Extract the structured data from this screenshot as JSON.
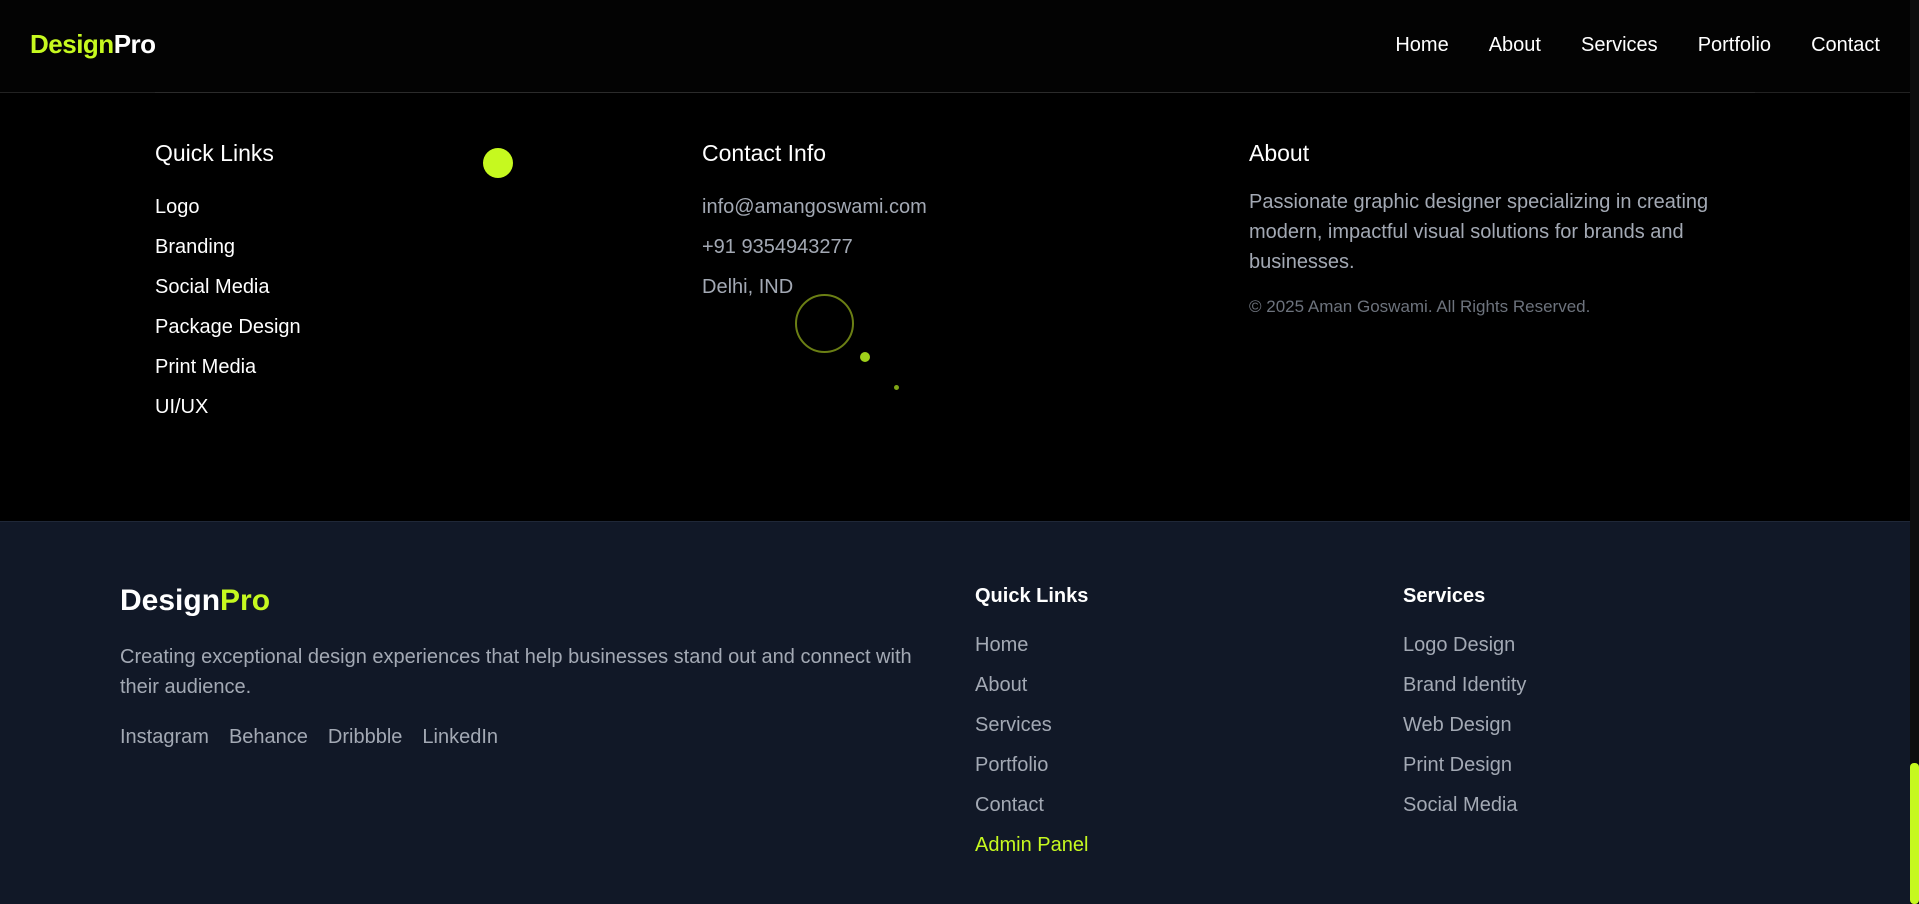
{
  "nav": {
    "logo_part1": "Design",
    "logo_part2": "Pro",
    "links": [
      "Home",
      "About",
      "Services",
      "Portfolio",
      "Contact"
    ]
  },
  "upper": {
    "quick_links": {
      "title": "Quick Links",
      "items": [
        "Logo",
        "Branding",
        "Social Media",
        "Package Design",
        "Print Media",
        "UI/UX"
      ]
    },
    "contact": {
      "title": "Contact Info",
      "email": "info@amangoswami.com",
      "phone": "+91 9354943277",
      "location": "Delhi, IND"
    },
    "about": {
      "title": "About",
      "text": "Passionate graphic designer specializing in creating modern, impactful visual solutions for brands and businesses.",
      "copyright": "© 2025 Aman Goswami. All Rights Reserved."
    }
  },
  "footer": {
    "logo_part1": "Design",
    "logo_part2": "Pro",
    "description": "Creating exceptional design experiences that help businesses stand out and connect with their audience.",
    "social": [
      "Instagram",
      "Behance",
      "Dribbble",
      "LinkedIn"
    ],
    "quick_links": {
      "title": "Quick Links",
      "items": [
        "Home",
        "About",
        "Services",
        "Portfolio",
        "Contact"
      ],
      "admin": "Admin Panel"
    },
    "services": {
      "title": "Services",
      "items": [
        "Logo Design",
        "Brand Identity",
        "Web Design",
        "Print Design",
        "Social Media"
      ]
    }
  },
  "colors": {
    "accent": "#c6f91f",
    "footer_bg": "#111827",
    "muted_text": "#a3a9b4"
  }
}
